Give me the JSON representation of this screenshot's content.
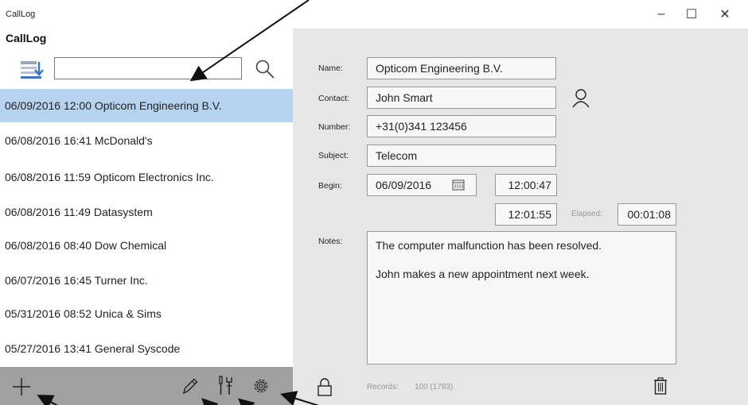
{
  "window": {
    "title": "CallLog",
    "minimize": "–",
    "maximize": "☐",
    "close": "✕"
  },
  "app": {
    "title": "CallLog"
  },
  "search": {
    "value": "",
    "placeholder": ""
  },
  "calls": [
    "06/09/2016 12:00 Opticom Engineering B.V.",
    "06/08/2016 16:41 McDonald's",
    "06/08/2016 11:59 Opticom Electronics Inc.",
    "06/08/2016 11:49 Datasystem",
    "06/08/2016 08:40 Dow Chemical",
    "06/07/2016 16:45 Turner Inc.",
    "05/31/2016 08:52 Unica & Sims",
    "05/27/2016 13:41 General Syscode"
  ],
  "form": {
    "name_label": "Name:",
    "name_value": "Opticom Engineering B.V.",
    "contact_label": "Contact:",
    "contact_value": "John Smart",
    "number_label": "Number:",
    "number_value": "+31(0)341 123456",
    "subject_label": "Subject:",
    "subject_value": "Telecom",
    "begin_label": "Begin:",
    "begin_date": "06/09/2016",
    "begin_time": "12:00:47",
    "end_time": "12:01:55",
    "elapsed_label": "Elapsed:",
    "elapsed_value": "00:01:08",
    "notes_label": "Notes:",
    "notes_line1": "The computer malfunction has been resolved.",
    "notes_line2": "John makes a new appointment next week.",
    "records_label": "Records:",
    "records_value": "100 (1783)"
  },
  "colors": {
    "selection": "#b5d3ef",
    "detail_bg": "#e6e6e6",
    "bottom_bar": "#a0a0a0"
  }
}
